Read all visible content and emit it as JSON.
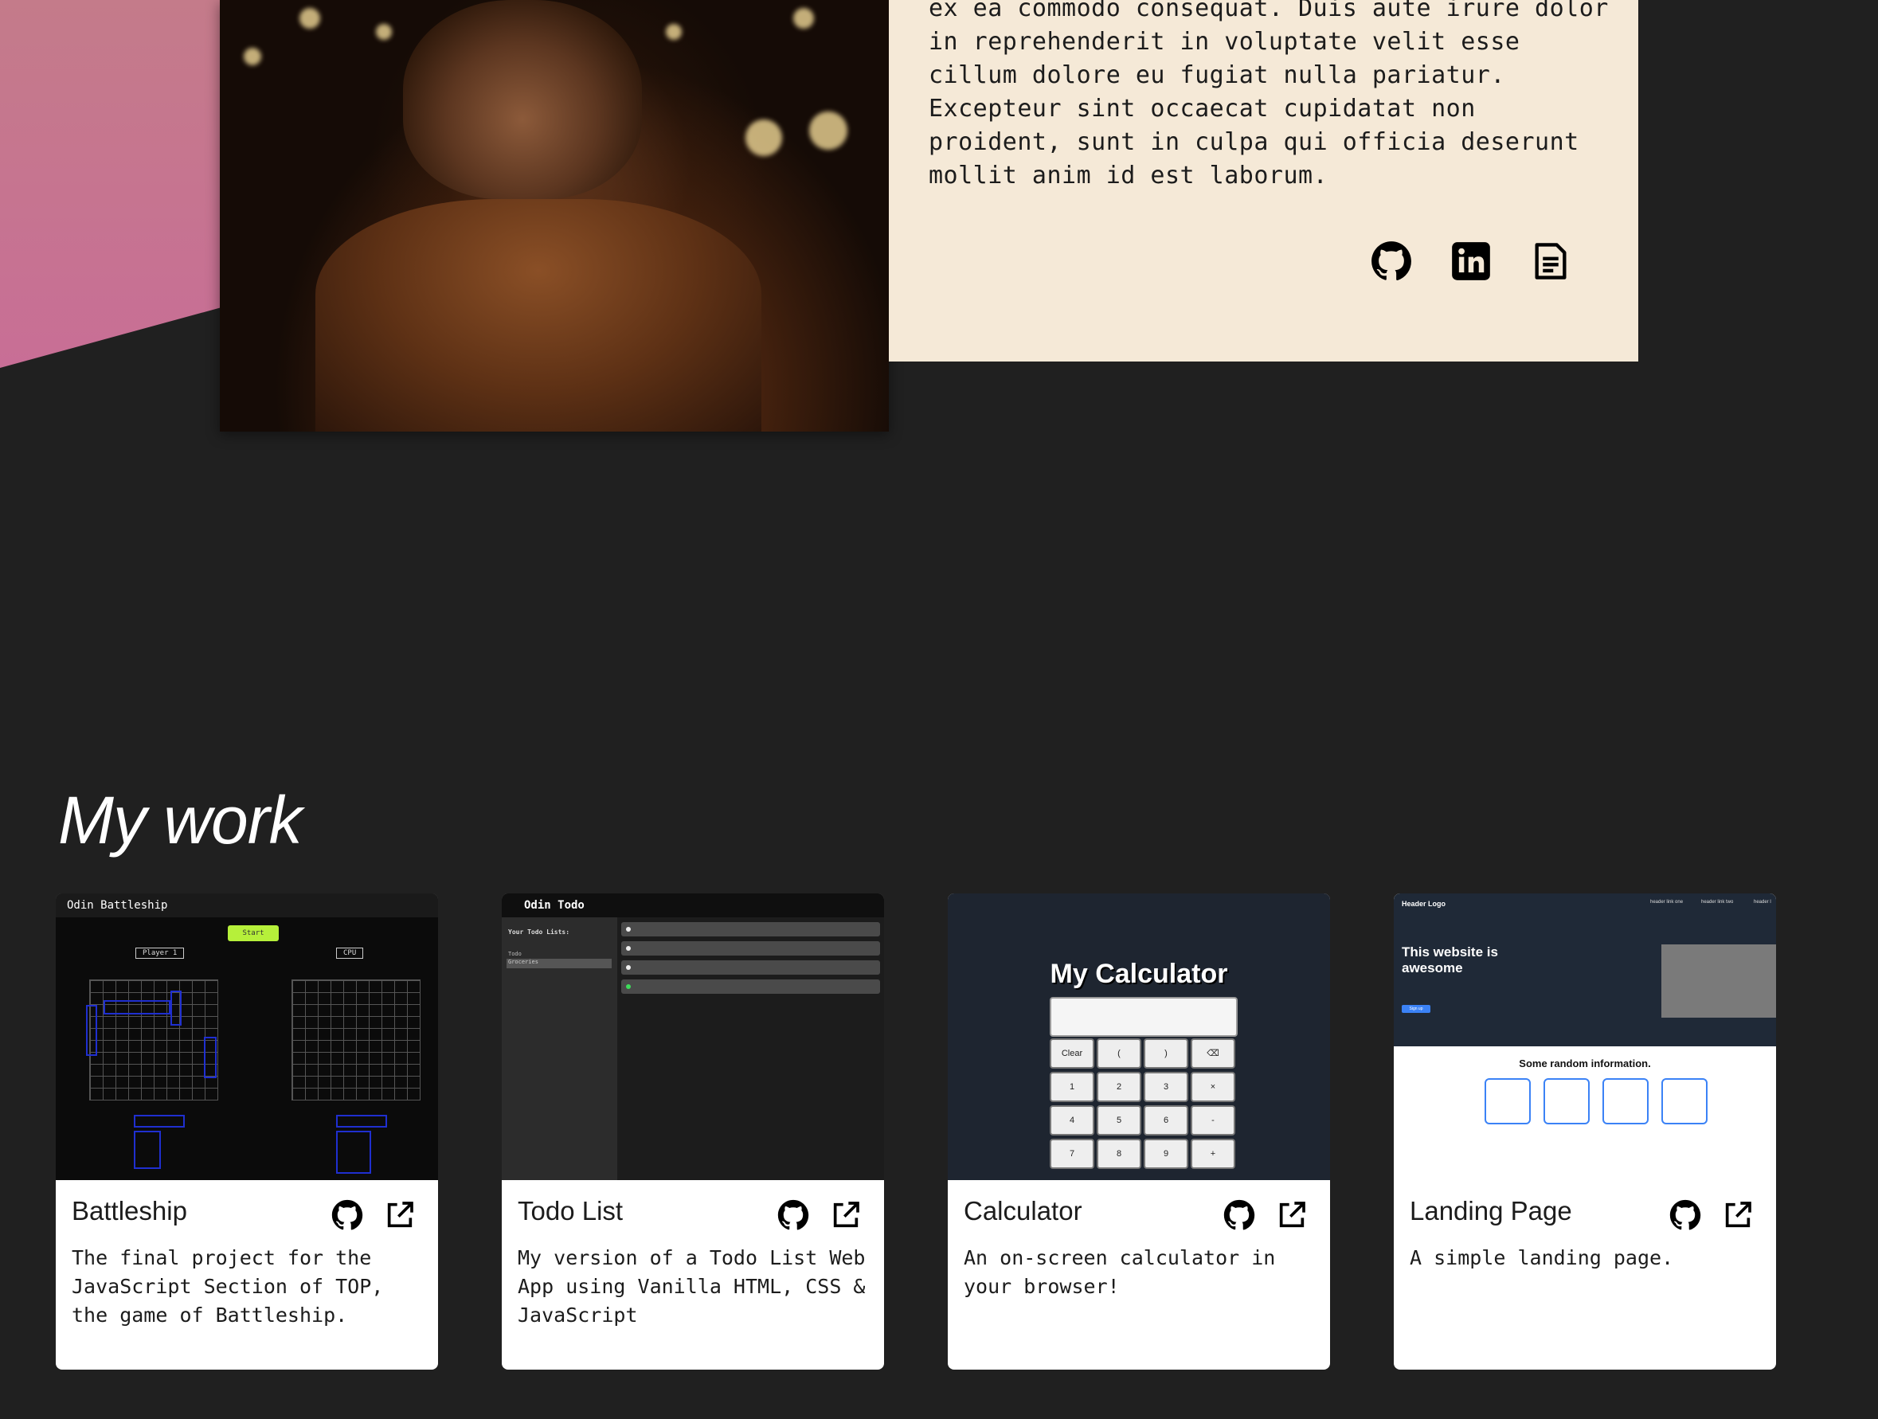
{
  "about": {
    "text": "ex ea commodo consequat. Duis aute irure dolor\nin reprehenderit in voluptate velit esse\ncillum dolore eu fugiat nulla pariatur.\nExcepteur sint occaecat cupidatat non\nproident, sunt in culpa qui officia deserunt\nmollit anim id est laborum.",
    "social": [
      {
        "icon": "github-icon"
      },
      {
        "icon": "linkedin-icon"
      },
      {
        "icon": "resume-document-icon"
      }
    ]
  },
  "section_title": "My work",
  "projects": [
    {
      "title": "Battleship",
      "description": "The final project for the JavaScript Section of TOP, the game of Battleship.",
      "thumb": {
        "app_title": "Odin Battleship",
        "button": "Start",
        "player_label": "Player 1",
        "cpu_label": "CPU"
      }
    },
    {
      "title": "Todo List",
      "description": "My version of a Todo List Web App using Vanilla HTML, CSS & JavaScript",
      "thumb": {
        "app_title": "Odin Todo",
        "sidebar_heading": "Your Todo Lists:",
        "sidebar_items": [
          "Todo",
          "Groceries"
        ]
      }
    },
    {
      "title": "Calculator",
      "description": "An on-screen calculator in your browser!",
      "thumb": {
        "app_title": "My Calculator",
        "keys": [
          "Clear",
          "(",
          ")",
          "⌫",
          "1",
          "2",
          "3",
          "×",
          "4",
          "5",
          "6",
          "-",
          "7",
          "8",
          "9",
          "+"
        ]
      }
    },
    {
      "title": "Landing Page",
      "description": "A simple landing page.",
      "thumb": {
        "logo": "Header Logo",
        "nav": [
          "header link one",
          "header link two",
          "header l"
        ],
        "hero_title": "This website is awesome",
        "hero_button": "Sign up",
        "info_heading": "Some random information."
      }
    }
  ],
  "colors": {
    "background": "#202020",
    "about_card": "#f5e9d7",
    "accent_pink": "#c47b8a",
    "card": "#ffffff"
  }
}
